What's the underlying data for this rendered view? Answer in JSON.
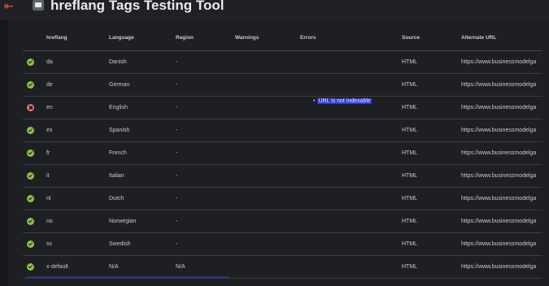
{
  "app": {
    "title": "hreflang Tags Testing Tool"
  },
  "table": {
    "headers": {
      "hreflang": "hreflang",
      "language": "Language",
      "region": "Region",
      "warnings": "Warnings",
      "errors": "Errors",
      "source": "Source",
      "alternate_url": "Alternate URL"
    },
    "rows": [
      {
        "status": "ok",
        "hreflang": "da",
        "language": "Danish",
        "region": "-",
        "warnings": "",
        "error": "",
        "source": "HTML",
        "url": "https://www.businessmodelga"
      },
      {
        "status": "ok",
        "hreflang": "de",
        "language": "German",
        "region": "-",
        "warnings": "",
        "error": "",
        "source": "HTML",
        "url": "https://www.businessmodelga"
      },
      {
        "status": "error",
        "hreflang": "en",
        "language": "English",
        "region": "-",
        "warnings": "",
        "error": "URL is not indexable",
        "source": "HTML",
        "url": "https://www.businessmodelga"
      },
      {
        "status": "ok",
        "hreflang": "es",
        "language": "Spanish",
        "region": "-",
        "warnings": "",
        "error": "",
        "source": "HTML",
        "url": "https://www.businessmodelga"
      },
      {
        "status": "ok",
        "hreflang": "fr",
        "language": "French",
        "region": "-",
        "warnings": "",
        "error": "",
        "source": "HTML",
        "url": "https://www.businessmodelga"
      },
      {
        "status": "ok",
        "hreflang": "it",
        "language": "Italian",
        "region": "-",
        "warnings": "",
        "error": "",
        "source": "HTML",
        "url": "https://www.businessmodelga"
      },
      {
        "status": "ok",
        "hreflang": "nl",
        "language": "Dutch",
        "region": "-",
        "warnings": "",
        "error": "",
        "source": "HTML",
        "url": "https://www.businessmodelga"
      },
      {
        "status": "ok",
        "hreflang": "no",
        "language": "Norwegian",
        "region": "-",
        "warnings": "",
        "error": "",
        "source": "HTML",
        "url": "https://www.businessmodelga"
      },
      {
        "status": "ok",
        "hreflang": "sv",
        "language": "Swedish",
        "region": "-",
        "warnings": "",
        "error": "",
        "source": "HTML",
        "url": "https://www.businessmodelga"
      },
      {
        "status": "ok",
        "hreflang": "x-default",
        "language": "N/A",
        "region": "N/A",
        "warnings": "",
        "error": "",
        "source": "HTML",
        "url": "https://www.businessmodelga"
      }
    ]
  },
  "colors": {
    "ok": "#8bc34a",
    "error": "#e57373",
    "highlight": "#2f3ad0",
    "accent": "#e0572f"
  },
  "icons": {
    "back": "back-arrow-icon",
    "app": "translate-icon"
  }
}
